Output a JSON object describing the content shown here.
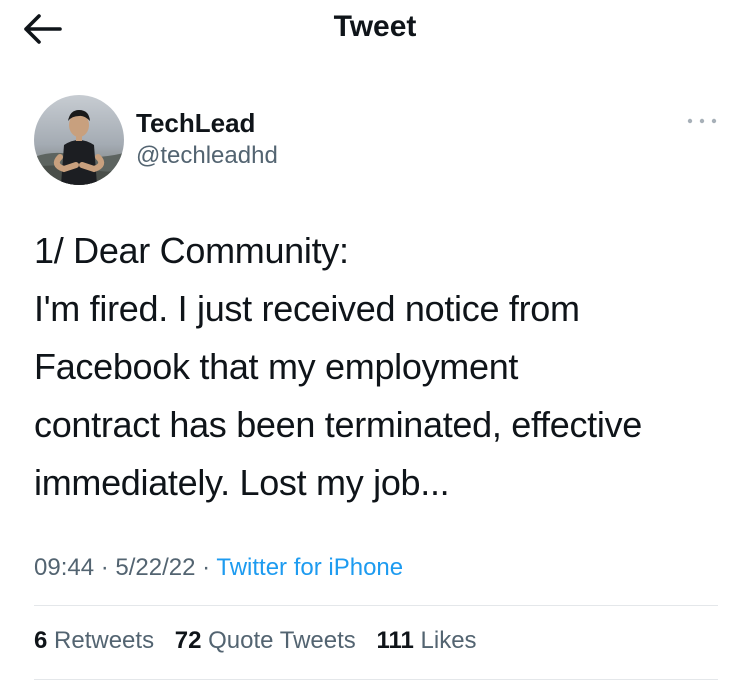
{
  "header": {
    "title": "Tweet",
    "back_icon": "arrow-left-icon"
  },
  "author": {
    "display_name": "TechLead",
    "handle": "@techleadhd",
    "more_icon": "more-horizontal-icon"
  },
  "tweet": {
    "lines": [
      "1/ Dear Community:",
      "I'm fired. I just received notice from",
      "Facebook that my employment",
      "contract has been terminated, effective",
      "immediately. Lost my job..."
    ]
  },
  "meta": {
    "time": "09:44",
    "sep1": " · ",
    "date": "5/22/22",
    "sep2": " · ",
    "source": "Twitter for iPhone"
  },
  "stats": {
    "retweets_count": "6",
    "retweets_label": "Retweets",
    "quotes_count": "72",
    "quotes_label": "Quote Tweets",
    "likes_count": "111",
    "likes_label": "Likes"
  },
  "colors": {
    "text": "#0f1419",
    "secondary": "#536471",
    "link": "#1d9bf0",
    "divider": "#e4e7ea"
  }
}
